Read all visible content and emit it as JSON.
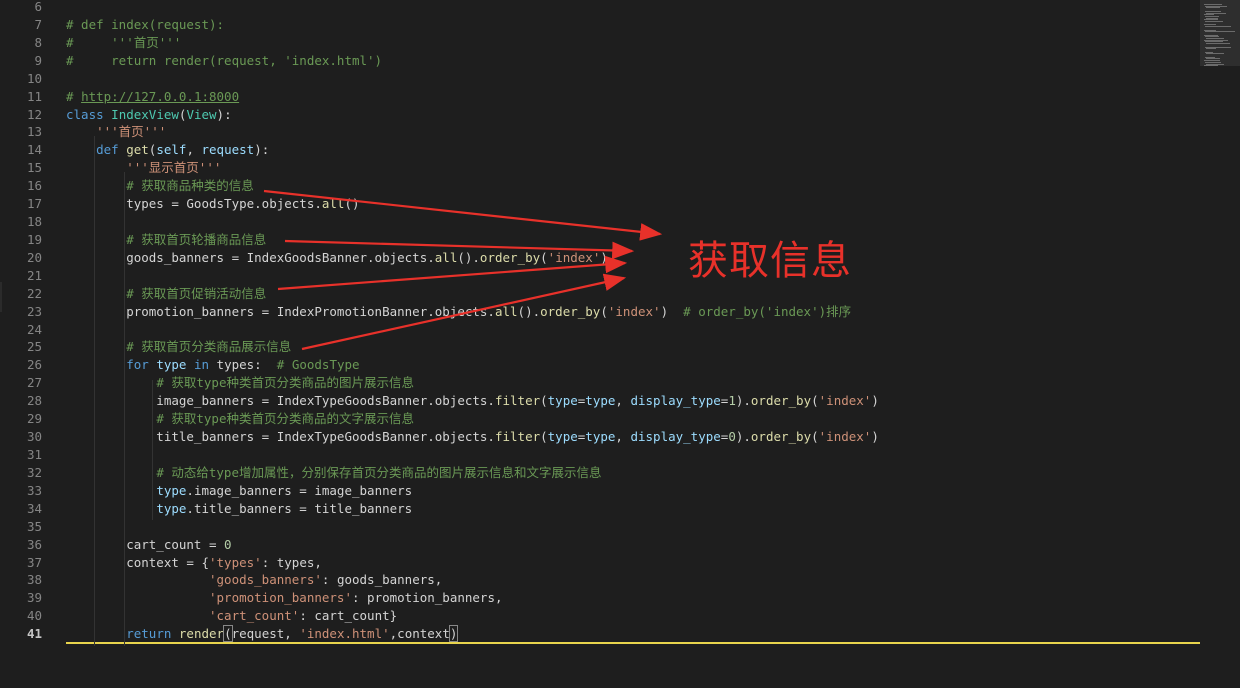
{
  "editor": {
    "active_line": "41",
    "lines": [
      {
        "n": "6",
        "tokens": []
      },
      {
        "n": "7",
        "tokens": [
          [
            "cm",
            "# def index(request):"
          ]
        ]
      },
      {
        "n": "8",
        "tokens": [
          [
            "cm",
            "#     '''首页'''"
          ]
        ]
      },
      {
        "n": "9",
        "tokens": [
          [
            "cm",
            "#     return render(request, 'index.html')"
          ]
        ]
      },
      {
        "n": "10",
        "tokens": []
      },
      {
        "n": "11",
        "tokens": [
          [
            "cm",
            "# "
          ],
          [
            "url",
            "http://127.0.0.1:8000"
          ]
        ]
      },
      {
        "n": "12",
        "tokens": [
          [
            "kw",
            "class"
          ],
          [
            "",
            "",
            " "
          ],
          [
            "cls",
            "IndexView"
          ],
          [
            "",
            "("
          ],
          [
            "cls",
            "View"
          ],
          [
            "",
            "):"
          ]
        ]
      },
      {
        "n": "13",
        "tokens": [
          [
            "",
            "    "
          ],
          [
            "str",
            "'''首页'''"
          ]
        ]
      },
      {
        "n": "14",
        "tokens": [
          [
            "",
            "    "
          ],
          [
            "kw",
            "def"
          ],
          [
            "",
            " "
          ],
          [
            "fn",
            "get"
          ],
          [
            "",
            "("
          ],
          [
            "prm",
            "self"
          ],
          [
            "",
            ", "
          ],
          [
            "prm",
            "request"
          ],
          [
            "",
            "):"
          ]
        ]
      },
      {
        "n": "15",
        "tokens": [
          [
            "",
            "        "
          ],
          [
            "str",
            "'''显示首页'''"
          ]
        ]
      },
      {
        "n": "16",
        "tokens": [
          [
            "",
            "        "
          ],
          [
            "cm",
            "# 获取商品种类的信息"
          ]
        ]
      },
      {
        "n": "17",
        "tokens": [
          [
            "",
            "        types = GoodsType.objects."
          ],
          [
            "fn",
            "all"
          ],
          [
            "",
            "()"
          ]
        ]
      },
      {
        "n": "18",
        "tokens": []
      },
      {
        "n": "19",
        "tokens": [
          [
            "",
            "        "
          ],
          [
            "cm",
            "# 获取首页轮播商品信息"
          ]
        ]
      },
      {
        "n": "20",
        "tokens": [
          [
            "",
            "        goods_banners = IndexGoodsBanner.objects."
          ],
          [
            "fn",
            "all"
          ],
          [
            "",
            "()."
          ],
          [
            "fn",
            "order_by"
          ],
          [
            "",
            "("
          ],
          [
            "str",
            "'index'"
          ],
          [
            "",
            ")"
          ]
        ]
      },
      {
        "n": "21",
        "tokens": []
      },
      {
        "n": "22",
        "tokens": [
          [
            "",
            "        "
          ],
          [
            "cm",
            "# 获取首页促销活动信息"
          ]
        ]
      },
      {
        "n": "23",
        "tokens": [
          [
            "",
            "        promotion_banners = IndexPromotionBanner.objects."
          ],
          [
            "fn",
            "all"
          ],
          [
            "",
            "()."
          ],
          [
            "fn",
            "order_by"
          ],
          [
            "",
            "("
          ],
          [
            "str",
            "'index'"
          ],
          [
            "",
            ")  "
          ],
          [
            "cm",
            "# order_by('index')排序"
          ]
        ]
      },
      {
        "n": "24",
        "tokens": []
      },
      {
        "n": "25",
        "tokens": [
          [
            "",
            "        "
          ],
          [
            "cm",
            "# 获取首页分类商品展示信息"
          ]
        ]
      },
      {
        "n": "26",
        "tokens": [
          [
            "",
            "        "
          ],
          [
            "kw",
            "for"
          ],
          [
            "",
            " "
          ],
          [
            "prm",
            "type"
          ],
          [
            "",
            " "
          ],
          [
            "kw",
            "in"
          ],
          [
            "",
            " types:  "
          ],
          [
            "cm",
            "# GoodsType"
          ]
        ]
      },
      {
        "n": "27",
        "tokens": [
          [
            "",
            "            "
          ],
          [
            "cm",
            "# 获取type种类首页分类商品的图片展示信息"
          ]
        ]
      },
      {
        "n": "28",
        "tokens": [
          [
            "",
            "            image_banners = IndexTypeGoodsBanner.objects."
          ],
          [
            "fn",
            "filter"
          ],
          [
            "",
            "("
          ],
          [
            "prm",
            "type"
          ],
          [
            "",
            "="
          ],
          [
            "prm",
            "type"
          ],
          [
            "",
            ", "
          ],
          [
            "prm",
            "display_type"
          ],
          [
            "",
            "="
          ],
          [
            "num",
            "1"
          ],
          [
            "",
            ")."
          ],
          [
            "fn",
            "order_by"
          ],
          [
            "",
            "("
          ],
          [
            "str",
            "'index'"
          ],
          [
            "",
            ")"
          ]
        ]
      },
      {
        "n": "29",
        "tokens": [
          [
            "",
            "            "
          ],
          [
            "cm",
            "# 获取type种类首页分类商品的文字展示信息"
          ]
        ]
      },
      {
        "n": "30",
        "tokens": [
          [
            "",
            "            title_banners = IndexTypeGoodsBanner.objects."
          ],
          [
            "fn",
            "filter"
          ],
          [
            "",
            "("
          ],
          [
            "prm",
            "type"
          ],
          [
            "",
            "="
          ],
          [
            "prm",
            "type"
          ],
          [
            "",
            ", "
          ],
          [
            "prm",
            "display_type"
          ],
          [
            "",
            "="
          ],
          [
            "num",
            "0"
          ],
          [
            "",
            ")."
          ],
          [
            "fn",
            "order_by"
          ],
          [
            "",
            "("
          ],
          [
            "str",
            "'index'"
          ],
          [
            "",
            ")"
          ]
        ]
      },
      {
        "n": "31",
        "tokens": []
      },
      {
        "n": "32",
        "tokens": [
          [
            "",
            "            "
          ],
          [
            "cm",
            "# 动态给type增加属性，分别保存首页分类商品的图片展示信息和文字展示信息"
          ]
        ]
      },
      {
        "n": "33",
        "tokens": [
          [
            "",
            "            "
          ],
          [
            "prm",
            "type"
          ],
          [
            "",
            ".image_banners = image_banners"
          ]
        ]
      },
      {
        "n": "34",
        "tokens": [
          [
            "",
            "            "
          ],
          [
            "prm",
            "type"
          ],
          [
            "",
            ".title_banners = title_banners"
          ]
        ]
      },
      {
        "n": "35",
        "tokens": []
      },
      {
        "n": "36",
        "tokens": [
          [
            "",
            "        cart_count = "
          ],
          [
            "num",
            "0"
          ]
        ]
      },
      {
        "n": "37",
        "tokens": [
          [
            "",
            "        context = {"
          ],
          [
            "str",
            "'types'"
          ],
          [
            "",
            ": types,"
          ]
        ]
      },
      {
        "n": "38",
        "tokens": [
          [
            "",
            "                   "
          ],
          [
            "str",
            "'goods_banners'"
          ],
          [
            "",
            ": goods_banners,"
          ]
        ]
      },
      {
        "n": "39",
        "tokens": [
          [
            "",
            "                   "
          ],
          [
            "str",
            "'promotion_banners'"
          ],
          [
            "",
            ": promotion_banners,"
          ]
        ]
      },
      {
        "n": "40",
        "tokens": [
          [
            "",
            "                   "
          ],
          [
            "str",
            "'cart_count'"
          ],
          [
            "",
            ": cart_count}"
          ]
        ]
      },
      {
        "n": "41",
        "tokens": [
          [
            "",
            "        "
          ],
          [
            "kw",
            "return"
          ],
          [
            "",
            " "
          ],
          [
            "fn",
            "render"
          ],
          [
            "brk",
            "("
          ],
          [
            "",
            "request, "
          ],
          [
            "str",
            "'index.html'"
          ],
          [
            "",
            ",context"
          ],
          [
            "brk",
            ")"
          ]
        ]
      }
    ]
  },
  "annotation": {
    "label": "获取信息",
    "color": "#e8312a"
  },
  "icons": {
    "minimap": "minimap-preview"
  }
}
